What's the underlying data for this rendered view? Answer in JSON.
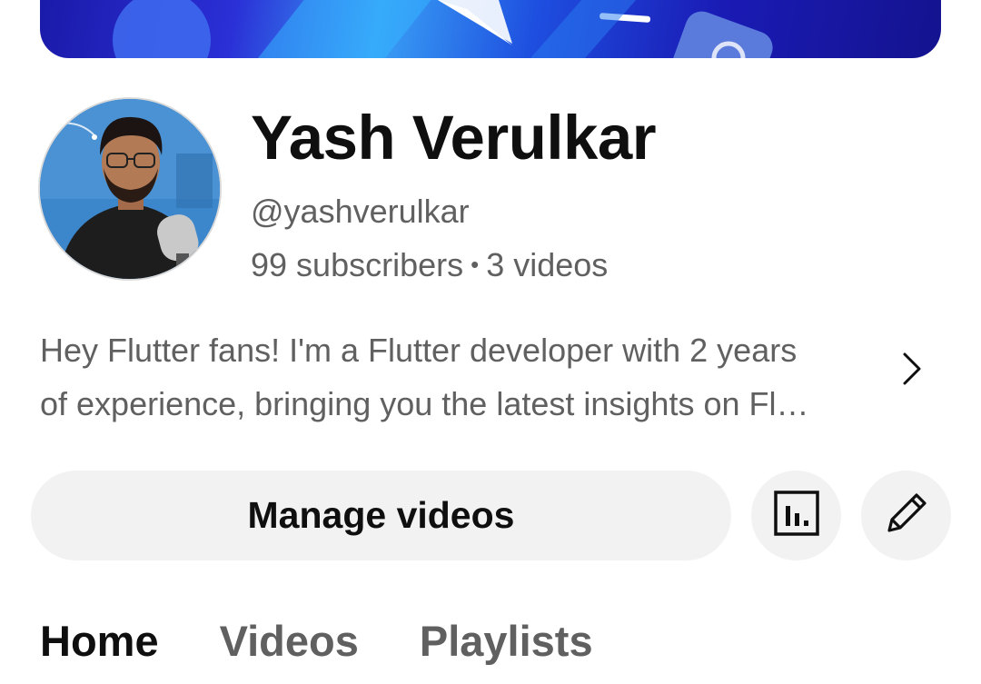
{
  "channel": {
    "name": "Yash Verulkar",
    "handle": "@yashverulkar",
    "subscribers": "99 subscribers",
    "separator": "•",
    "videos": "3 videos",
    "description_line1": "Hey Flutter fans! I'm a Flutter developer with 2 years",
    "description_line2": "of experience, bringing you the latest insights on Fl…"
  },
  "actions": {
    "manage_videos_label": "Manage videos",
    "analytics_icon": "analytics-icon",
    "edit_icon": "pencil-icon"
  },
  "tabs": [
    {
      "label": "Home",
      "active": true
    },
    {
      "label": "Videos",
      "active": false
    },
    {
      "label": "Playlists",
      "active": false
    }
  ],
  "colors": {
    "primary_text": "#0f0f0f",
    "secondary_text": "#606060",
    "button_bg": "#f2f2f2",
    "banner_blue": "#1a1bb5"
  }
}
